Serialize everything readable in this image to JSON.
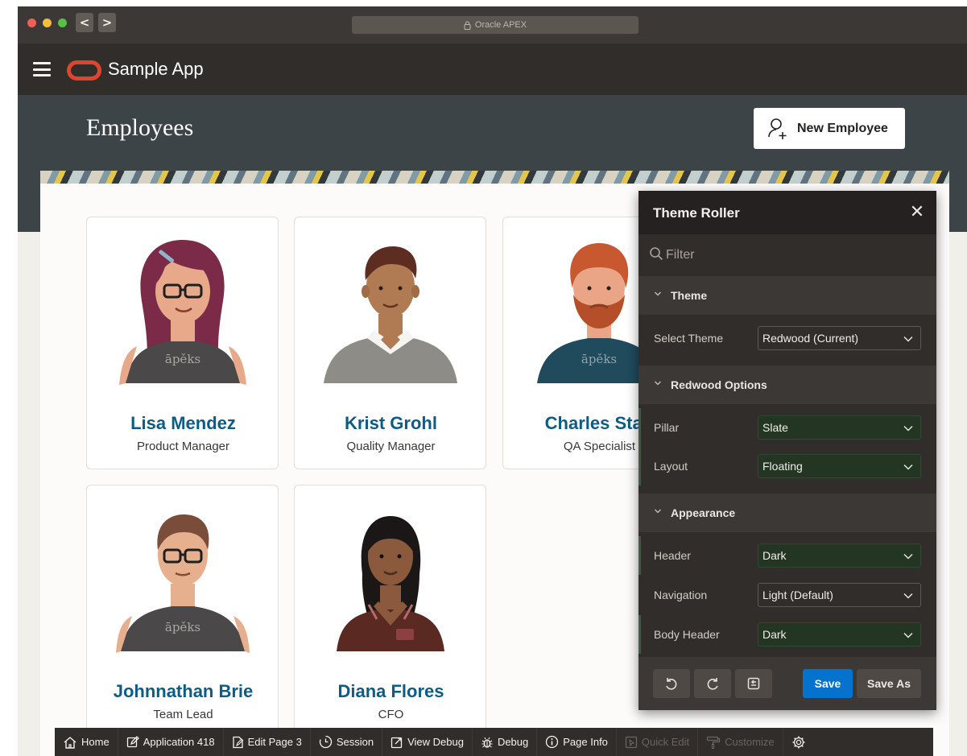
{
  "browser": {
    "url_text": "Oracle APEX",
    "back_glyph": "<",
    "forward_glyph": ">",
    "traffic_lights": [
      "#ee5f58",
      "#f6bd3b",
      "#56c242"
    ]
  },
  "app": {
    "title": "Sample App",
    "brand_color": "#e0442f"
  },
  "page": {
    "title": "Employees",
    "new_button_label": "New Employee"
  },
  "employees": [
    {
      "name": "Lisa Mendez",
      "role": "Product Manager",
      "avatar": "woman-glasses-avatar"
    },
    {
      "name": "Krist Grohl",
      "role": "Quality Manager",
      "avatar": "man-sweater-avatar"
    },
    {
      "name": "Charles Statt",
      "role": "QA Specialist",
      "avatar": "bearded-man-avatar"
    },
    {
      "name": "Johnnathan Brie",
      "role": "Team Lead",
      "avatar": "man-glasses-avatar"
    },
    {
      "name": "Diana Flores",
      "role": "CFO",
      "avatar": "woman-uniform-avatar"
    }
  ],
  "apeks_label": "āpěks",
  "theme_roller": {
    "title": "Theme Roller",
    "filter_placeholder": "Filter",
    "sections": {
      "theme": "Theme",
      "redwood": "Redwood Options",
      "appearance": "Appearance"
    },
    "rows": {
      "select_theme": {
        "label": "Select Theme",
        "value": "Redwood (Current)"
      },
      "pillar": {
        "label": "Pillar",
        "value": "Slate"
      },
      "layout": {
        "label": "Layout",
        "value": "Floating"
      },
      "header": {
        "label": "Header",
        "value": "Dark"
      },
      "navigation": {
        "label": "Navigation",
        "value": "Light (Default)"
      },
      "body_header": {
        "label": "Body Header",
        "value": "Dark"
      }
    },
    "save_label": "Save",
    "save_as_label": "Save As",
    "save_color": "#0572ce"
  },
  "dev_toolbar": {
    "home": "Home",
    "application": "Application 418",
    "edit_page": "Edit Page 3",
    "session": "Session",
    "view_debug": "View Debug",
    "debug": "Debug",
    "page_info": "Page Info",
    "quick_edit": "Quick Edit",
    "customize": "Customize"
  }
}
